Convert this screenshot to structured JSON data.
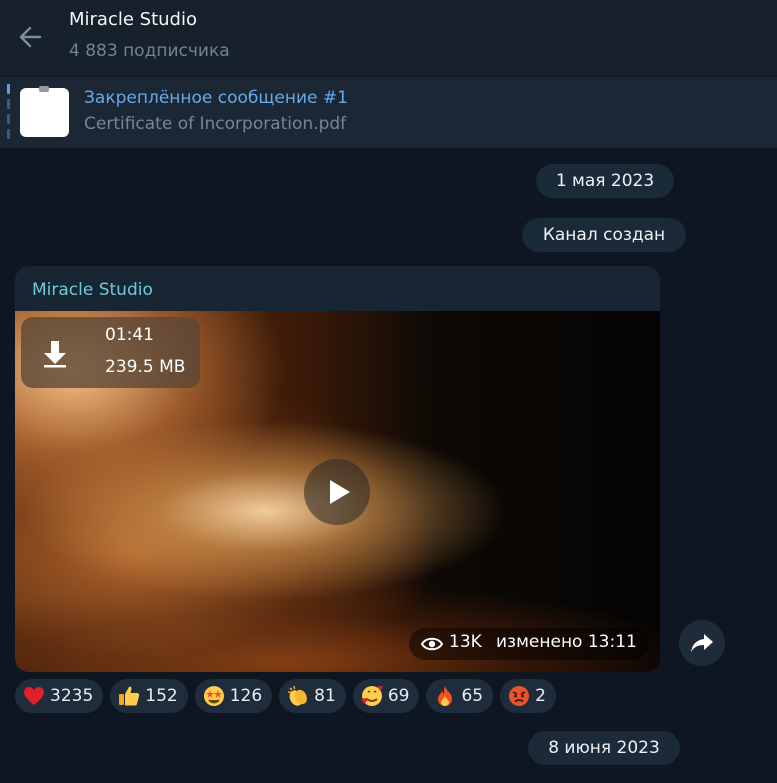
{
  "header": {
    "title": "Miracle Studio",
    "subtitle": "4 883 подписчика"
  },
  "pinned": {
    "title": "Закреплённое сообщение #1",
    "subtitle": "Certificate of Incorporation.pdf"
  },
  "dates": {
    "first": "1 мая 2023",
    "second": "8 июня 2023"
  },
  "service": "Канал создан",
  "post": {
    "author": "Miracle Studio",
    "video_duration": "01:41",
    "video_size": "239.5 MB",
    "views": "13K",
    "edited": "изменено 13:11"
  },
  "reactions": [
    {
      "emoji": "heart-icon",
      "count": "3235"
    },
    {
      "emoji": "thumbs-up-icon",
      "count": "152"
    },
    {
      "emoji": "star-struck-icon",
      "count": "126"
    },
    {
      "emoji": "clapping-hands-icon",
      "count": "81"
    },
    {
      "emoji": "smiling-hearts-icon",
      "count": "69"
    },
    {
      "emoji": "fire-icon",
      "count": "65"
    },
    {
      "emoji": "angry-face-icon",
      "count": "2"
    }
  ]
}
